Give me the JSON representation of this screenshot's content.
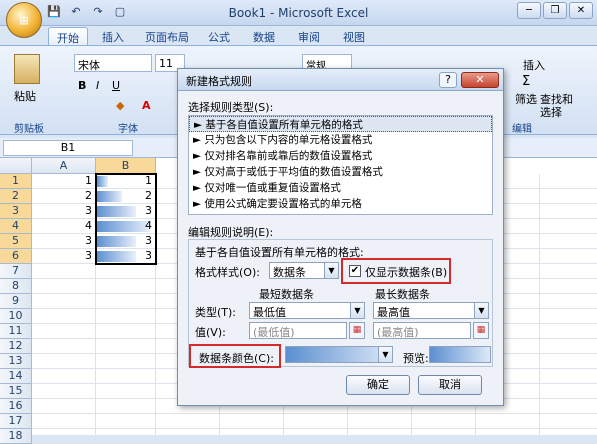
{
  "window": {
    "title": "Book1 - Microsoft Excel",
    "controls": [
      "─",
      "❐",
      "✕"
    ]
  },
  "office_button": "⊞",
  "qat_icons": [
    "💾",
    "↶",
    "↷",
    "▢"
  ],
  "tabs": [
    "开始",
    "插入",
    "页面布局",
    "公式",
    "数据",
    "审阅",
    "视图"
  ],
  "ribbon": {
    "paste": "粘贴",
    "clipboard": "剪贴板",
    "font_name": "宋体",
    "font_size": "11",
    "font_group": "字体",
    "number_format": "常规",
    "insert": "插入",
    "filter": "筛选",
    "select": "选择",
    "find": "查找和",
    "edit_group": "编辑"
  },
  "formula": {
    "name_box": "B1",
    "fx": "fx"
  },
  "grid": {
    "col_a": "A",
    "col_b": "B",
    "rows": [
      {
        "n": "1",
        "a": "1",
        "b": "1",
        "bar": 0.2
      },
      {
        "n": "2",
        "a": "2",
        "b": "2",
        "bar": 0.45
      },
      {
        "n": "3",
        "a": "3",
        "b": "3",
        "bar": 0.7
      },
      {
        "n": "4",
        "a": "4",
        "b": "4",
        "bar": 0.95
      },
      {
        "n": "5",
        "a": "3",
        "b": "3",
        "bar": 0.7
      },
      {
        "n": "6",
        "a": "3",
        "b": "3",
        "bar": 0.7
      },
      {
        "n": "7"
      },
      {
        "n": "8"
      },
      {
        "n": "9"
      },
      {
        "n": "10"
      },
      {
        "n": "11"
      },
      {
        "n": "12"
      },
      {
        "n": "13"
      },
      {
        "n": "14"
      },
      {
        "n": "15"
      },
      {
        "n": "16"
      },
      {
        "n": "17"
      },
      {
        "n": "18"
      }
    ]
  },
  "dialog": {
    "title": "新建格式规则",
    "help": "?",
    "close": "✕",
    "select_type_label": "选择规则类型(S):",
    "rules": [
      "基于各自值设置所有单元格的格式",
      "只为包含以下内容的单元格设置格式",
      "仅对排名靠前或靠后的数值设置格式",
      "仅对高于或低于平均值的数值设置格式",
      "仅对唯一值或重复值设置格式",
      "使用公式确定要设置格式的单元格"
    ],
    "edit_desc_label": "编辑规则说明(E):",
    "desc_header": "基于各自值设置所有单元格的格式:",
    "format_style_label": "格式样式(O):",
    "format_style_value": "数据条",
    "show_bar_only": "仅显示数据条(B)",
    "shortest_label": "最短数据条",
    "longest_label": "最长数据条",
    "type_label": "类型(T):",
    "type_min": "最低值",
    "type_max": "最高值",
    "value_label": "值(V):",
    "value_min": "(最低值)",
    "value_max": "(最高值)",
    "bar_color_label": "数据条颜色(C):",
    "preview_label": "预览:",
    "ok": "确定",
    "cancel": "取消"
  }
}
